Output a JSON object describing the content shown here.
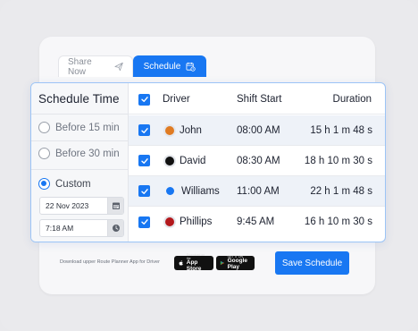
{
  "tabs": [
    {
      "label": "Share Now",
      "icon": "send-icon",
      "active": false
    },
    {
      "label": "Schedule",
      "icon": "calendar-clock-icon",
      "active": true
    }
  ],
  "schedule_time": {
    "title": "Schedule Time",
    "options": [
      {
        "label": "Before 15 min",
        "selected": false
      },
      {
        "label": "Before 30 min",
        "selected": false
      },
      {
        "label": "Custom",
        "selected": true
      }
    ],
    "date_value": "22 Nov 2023",
    "time_value": "7:18 AM"
  },
  "table": {
    "headers": {
      "driver": "Driver",
      "shift_start": "Shift Start",
      "duration": "Duration"
    },
    "rows": [
      {
        "name": "John",
        "shift_start": "08:00 AM",
        "duration": "15 h 1 m 48 s",
        "dot_color": "#e07b22",
        "checked": true
      },
      {
        "name": "David",
        "shift_start": "08:30 AM",
        "duration": "18 h 10 m 30 s",
        "dot_color": "#111111",
        "checked": true
      },
      {
        "name": "Williams",
        "shift_start": "11:00 AM",
        "duration": "22 h 1 m 48 s",
        "dot_color": "#1877f2",
        "checked": true
      },
      {
        "name": "Phillips",
        "shift_start": "9:45 AM",
        "duration": "16 h 10 m 30 s",
        "dot_color": "#b3181c",
        "checked": true
      }
    ]
  },
  "footer": {
    "download_text": "Download upper Route Planner App for Driver",
    "app_store": {
      "small": "Download on the",
      "big": "App Store"
    },
    "google_play": {
      "small": "GET IT ON",
      "big": "Google Play"
    },
    "save_label": "Save Schedule"
  },
  "colors": {
    "accent": "#1877f2",
    "panel_border": "#9cc4f6"
  }
}
